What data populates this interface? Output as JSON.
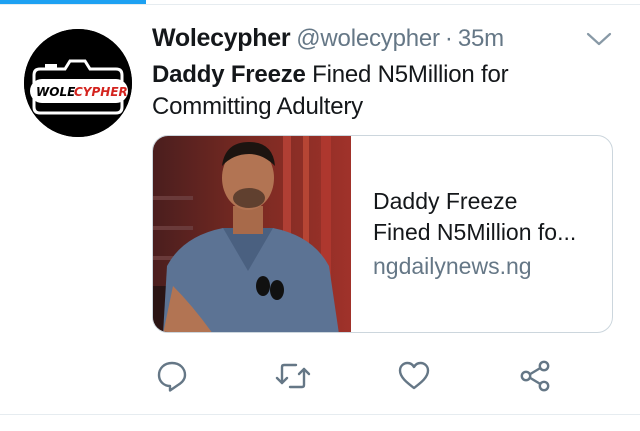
{
  "tweet": {
    "author_name": "Wolecypher",
    "handle": "@wolecypher",
    "separator": "·",
    "time": "35m",
    "text_bold": "Daddy Freeze",
    "text_rest": " Fined N5Million for Committing Adultery",
    "avatar_logo_text": "WOLECYPHER"
  },
  "card": {
    "title_line1": "Daddy Freeze",
    "title_line2": "Fined N5Million fo...",
    "domain": "ngdailynews.ng"
  },
  "icons": {
    "menu": "chevron-down-icon",
    "reply": "reply-icon",
    "retweet": "retweet-icon",
    "like": "heart-icon",
    "share": "share-icon"
  },
  "colors": {
    "accent": "#1da1f2",
    "text": "#14171a",
    "secondary": "#657786",
    "border": "#ccd6dd"
  }
}
